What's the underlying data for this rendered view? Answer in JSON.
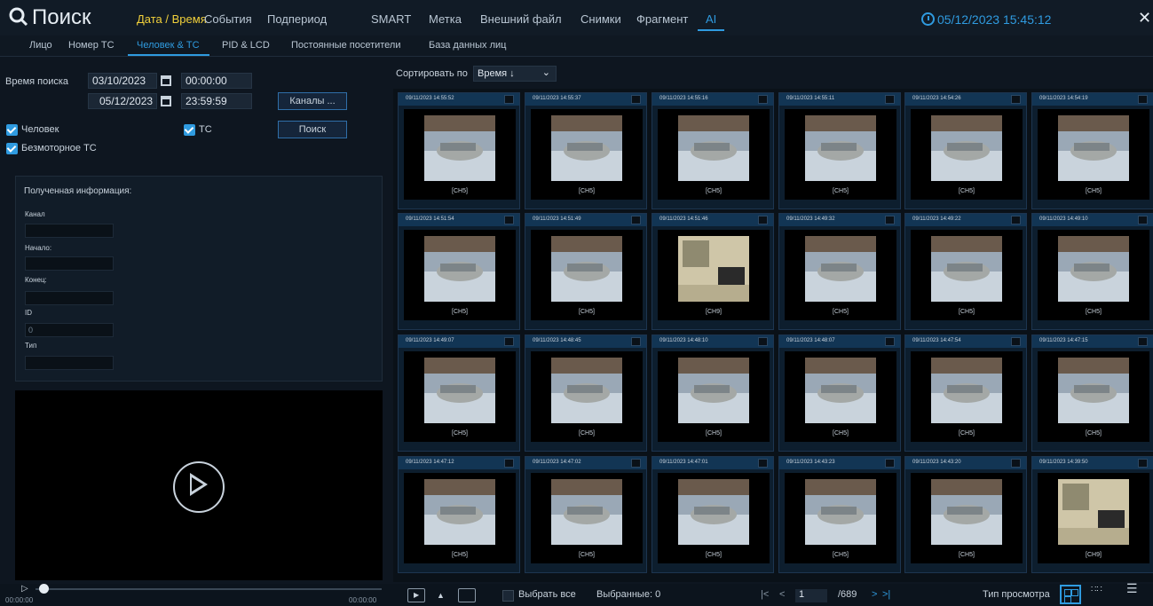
{
  "header": {
    "title": "Поиск",
    "tabs": [
      {
        "label": "Дата / Время",
        "state": "active"
      },
      {
        "label": "События"
      },
      {
        "label": "Подпериод"
      },
      {
        "label": "SMART"
      },
      {
        "label": "Метка"
      },
      {
        "label": "Внешний файл"
      },
      {
        "label": "Снимки"
      },
      {
        "label": "Фрагмент"
      },
      {
        "label": "AI",
        "state": "selected"
      }
    ],
    "datetime": "05/12/2023 15:45:12",
    "close_icon": "close-icon"
  },
  "subtabs": [
    {
      "label": "Лицо"
    },
    {
      "label": "Номер ТС"
    },
    {
      "label": "Человек & ТС",
      "active": true
    },
    {
      "label": "PID & LCD"
    },
    {
      "label": "Постоянные посетители"
    },
    {
      "label": "База данных лиц"
    }
  ],
  "search": {
    "time_label": "Время поиска",
    "start_date": "03/10/2023",
    "start_time": "00:00:00",
    "end_date": "05/12/2023",
    "end_time": "23:59:59",
    "channels_button": "Каналы ...",
    "search_button": "Поиск",
    "checkbox_person": "Человек",
    "checkbox_vehicle": "ТС",
    "checkbox_nonmotor": "Безмоторное ТС"
  },
  "info": {
    "title": "Полученная информация:",
    "channel_label": "Канал",
    "start_label": "Начало:",
    "end_label": "Конец:",
    "id_label": "ID",
    "id_value": "0",
    "type_label": "Тип"
  },
  "player": {
    "time_start": "00:00:00",
    "time_end": "00:00:00"
  },
  "sort": {
    "label": "Сортировать по",
    "value": "Время ↓"
  },
  "results": [
    {
      "time": "09/11/2023 14:55:52",
      "channel": "[CH5]"
    },
    {
      "time": "09/11/2023 14:55:37",
      "channel": "[CH5]"
    },
    {
      "time": "09/11/2023 14:55:16",
      "channel": "[CH5]"
    },
    {
      "time": "09/11/2023 14:55:11",
      "channel": "[CH5]"
    },
    {
      "time": "09/11/2023 14:54:26",
      "channel": "[CH5]"
    },
    {
      "time": "09/11/2023 14:54:19",
      "channel": "[CH5]"
    },
    {
      "time": "09/11/2023 14:51:54",
      "channel": "[CH5]"
    },
    {
      "time": "09/11/2023 14:51:49",
      "channel": "[CH5]"
    },
    {
      "time": "09/11/2023 14:51:46",
      "channel": "[CH9]"
    },
    {
      "time": "09/11/2023 14:49:32",
      "channel": "[CH5]"
    },
    {
      "time": "09/11/2023 14:49:22",
      "channel": "[CH5]"
    },
    {
      "time": "09/11/2023 14:49:10",
      "channel": "[CH5]"
    },
    {
      "time": "09/11/2023 14:49:07",
      "channel": "[CH5]"
    },
    {
      "time": "09/11/2023 14:48:45",
      "channel": "[CH5]"
    },
    {
      "time": "09/11/2023 14:48:10",
      "channel": "[CH5]"
    },
    {
      "time": "09/11/2023 14:48:07",
      "channel": "[CH5]"
    },
    {
      "time": "09/11/2023 14:47:54",
      "channel": "[CH5]"
    },
    {
      "time": "09/11/2023 14:47:15",
      "channel": "[CH5]"
    },
    {
      "time": "09/11/2023 14:47:12",
      "channel": "[CH5]"
    },
    {
      "time": "09/11/2023 14:47:02",
      "channel": "[CH5]"
    },
    {
      "time": "09/11/2023 14:47:01",
      "channel": "[CH5]"
    },
    {
      "time": "09/11/2023 14:43:23",
      "channel": "[CH5]"
    },
    {
      "time": "09/11/2023 14:43:20",
      "channel": "[CH5]"
    },
    {
      "time": "09/11/2023 14:39:50",
      "channel": "[CH9]"
    }
  ],
  "footer": {
    "select_all": "Выбрать все",
    "selected": "Выбранные: 0",
    "page": "1",
    "total_pages": "/689",
    "view_type_label": "Тип просмотра"
  },
  "colors": {
    "accent": "#2f9be0",
    "active_tab": "#f2d13b"
  }
}
